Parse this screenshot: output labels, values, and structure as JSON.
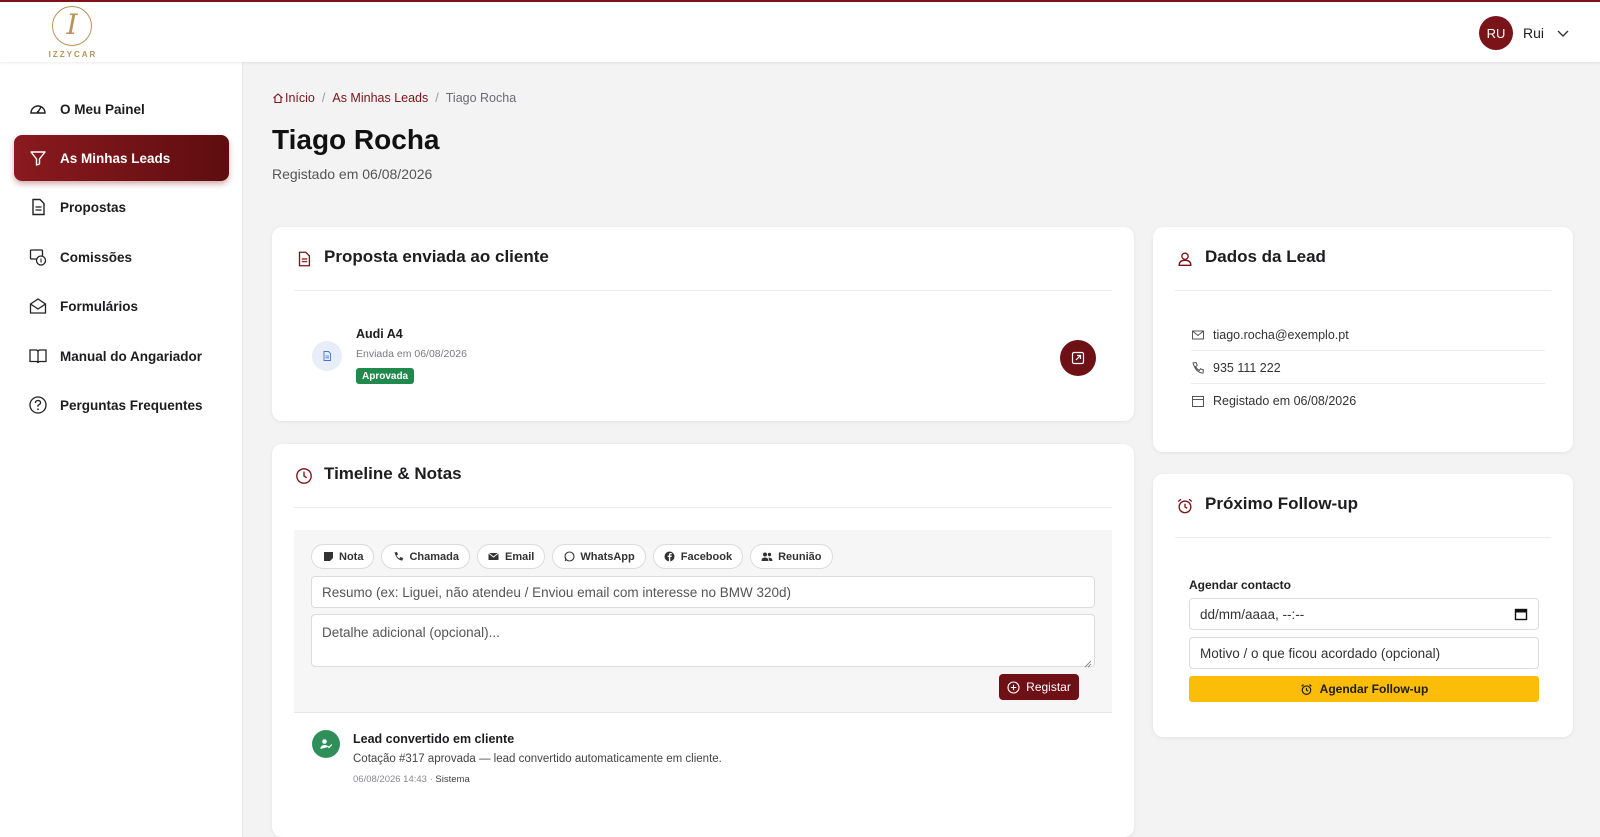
{
  "brand": {
    "name": "IZZYCAR",
    "initial": "I",
    "accent": "#7a1418",
    "gold": "#b8935a"
  },
  "user": {
    "initials": "RU",
    "name": "Rui"
  },
  "sidebar": {
    "items": [
      {
        "label": "O Meu Painel",
        "icon": "speedometer-icon"
      },
      {
        "label": "As Minhas Leads",
        "icon": "funnel-icon",
        "active": true
      },
      {
        "label": "Propostas",
        "icon": "document-icon"
      },
      {
        "label": "Comissões",
        "icon": "commission-icon"
      },
      {
        "label": "Formulários",
        "icon": "envelope-icon"
      },
      {
        "label": "Manual do Angariador",
        "icon": "book-icon"
      },
      {
        "label": "Perguntas Frequentes",
        "icon": "question-icon"
      }
    ]
  },
  "breadcrumb": {
    "home": "Início",
    "leads": "As Minhas Leads",
    "current": "Tiago Rocha"
  },
  "page": {
    "title": "Tiago Rocha",
    "subtitle": "Registado em 06/08/2026"
  },
  "proposal": {
    "heading": "Proposta enviada ao cliente",
    "car": "Audi A4",
    "sent": "Enviada em 06/08/2026",
    "status": "Aprovada",
    "status_color": "#1f8a4c"
  },
  "timeline": {
    "heading": "Timeline & Notas",
    "chips": [
      "Nota",
      "Chamada",
      "Email",
      "WhatsApp",
      "Facebook",
      "Reunião"
    ],
    "summary_placeholder": "Resumo (ex: Liguei, não atendeu / Enviou email com interesse no BMW 320d)",
    "detail_placeholder": "Detalhe adicional (opcional)...",
    "register_label": "Registar",
    "entry": {
      "title": "Lead convertido em cliente",
      "text": "Cotação #317 aprovada — lead convertido automaticamente em cliente.",
      "date": "06/08/2026 14:43",
      "author": "Sistema"
    }
  },
  "lead": {
    "heading": "Dados da Lead",
    "email": "tiago.rocha@exemplo.pt",
    "phone": "935 111 222",
    "registered": "Registado em 06/08/2026"
  },
  "followup": {
    "heading": "Próximo Follow-up",
    "label": "Agendar contacto",
    "date_placeholder": "dd/mm/aaaa, --:--",
    "reason_placeholder": "Motivo / o que ficou acordado (opcional)",
    "button_label": "Agendar Follow-up",
    "button_color": "#fbbd08"
  }
}
